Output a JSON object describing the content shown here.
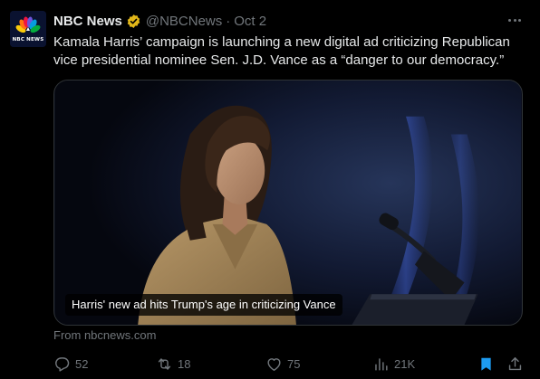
{
  "author": {
    "name": "NBC News",
    "handle": "@NBCNews",
    "separator": "·",
    "date": "Oct 2",
    "avatar_text": "NBC NEWS",
    "verified_color": "#e2b719",
    "peacock_colors": [
      "#fccb0a",
      "#ff7112",
      "#ef1541",
      "#6e55dc",
      "#069de0",
      "#05ac3f"
    ]
  },
  "tweet": {
    "text": "Kamala Harris’ campaign is launching a new digital ad criticizing Republican vice presidential nominee Sen. J.D. Vance as a “danger to our democracy.”"
  },
  "card": {
    "title": "Harris' new ad hits Trump's age in criticizing Vance",
    "source": "From nbcnews.com",
    "photo_subject": "woman speaking at a podium with a microphone"
  },
  "actions": {
    "reply_count": "52",
    "repost_count": "18",
    "like_count": "75",
    "view_count": "21K",
    "bookmarked": true,
    "bookmark_color": "#1d9bf0"
  },
  "theme": {
    "background": "#000000",
    "text": "#e7e9ea",
    "muted": "#71767b",
    "border": "#2f3336"
  }
}
